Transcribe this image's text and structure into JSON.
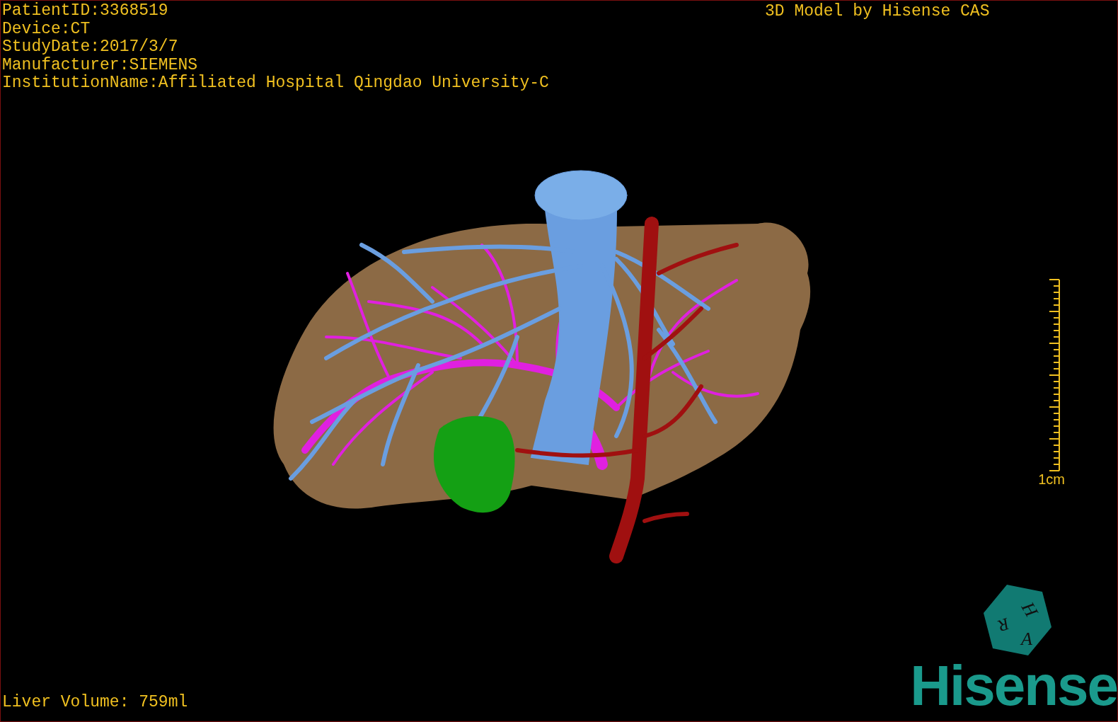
{
  "info_lines": [
    "PatientID:3368519",
    "Device:CT",
    "StudyDate:2017/3/7",
    "Manufacturer:SIEMENS",
    "InstitutionName:Affiliated Hospital Qingdao University-C"
  ],
  "title": "3D Model by Hisense CAS",
  "scale_bar": {
    "label": "1cm"
  },
  "volume": "Liver Volume: 759ml",
  "orientation_cube": {
    "faces": [
      "H",
      "R",
      "A"
    ]
  },
  "logo": "Hisense"
}
